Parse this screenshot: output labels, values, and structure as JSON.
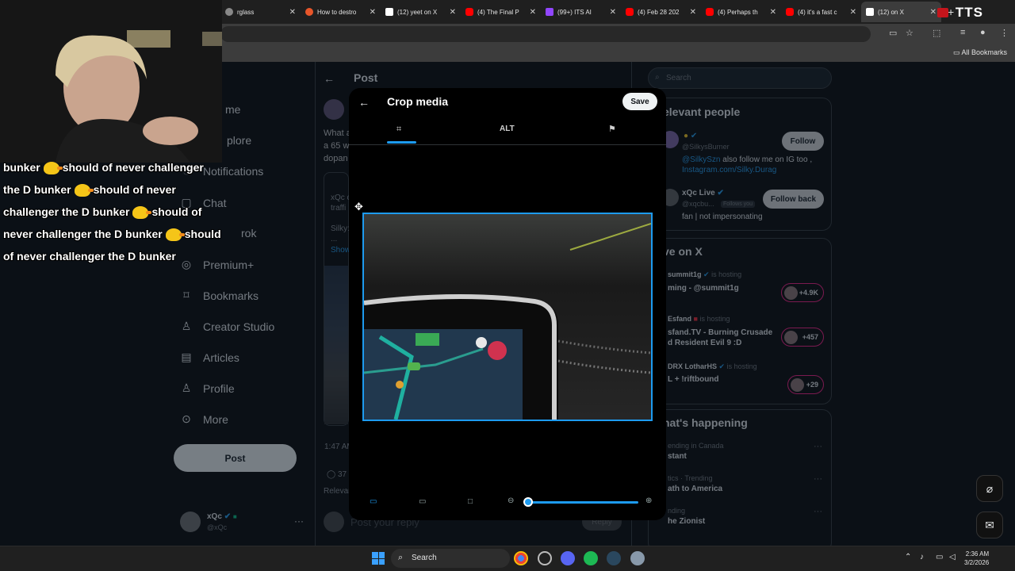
{
  "browser": {
    "tabs": [
      {
        "title": "rglass",
        "color": "#888888"
      },
      {
        "title": "How to destro",
        "color": "#e8562a"
      },
      {
        "title": "(12) yeet on X",
        "color": "#ffffff"
      },
      {
        "title": "(4) The Final P",
        "color": "#ff0000"
      },
      {
        "title": "(99+) ITS AI",
        "color": "#9146ff"
      },
      {
        "title": "(4) Feb 28 202",
        "color": "#ff0000"
      },
      {
        "title": "(4) Perhaps th",
        "color": "#ff0000"
      },
      {
        "title": "(4) it's a fast c",
        "color": "#ff0000"
      },
      {
        "title": "(12) on X",
        "color": "#ffffff"
      }
    ],
    "new_tab": "+",
    "close_glyph": "✕",
    "overlay_brand": "TTS",
    "all_bookmarks": "All Bookmarks"
  },
  "left_nav": {
    "items": [
      {
        "icon": "⌂",
        "label": "Home",
        "visible_label": "me"
      },
      {
        "icon": "⌕",
        "label": "Explore",
        "visible_label": "plore"
      },
      {
        "icon": "🔔",
        "label": "Notifications"
      },
      {
        "icon": "✉",
        "label": "Chat"
      },
      {
        "icon": "Ø",
        "label": "Grok",
        "visible_label": "rok"
      },
      {
        "icon": "✓",
        "label": "Premium+"
      },
      {
        "icon": "🔖",
        "label": "Bookmarks"
      },
      {
        "icon": "⚲",
        "label": "Creator Studio"
      },
      {
        "icon": "▤",
        "label": "Articles"
      },
      {
        "icon": "☺",
        "label": "Profile"
      },
      {
        "icon": "⋯",
        "label": "More"
      }
    ],
    "post_button": "Post",
    "account": {
      "name": "xQc",
      "handle": "@xQc",
      "more": "···"
    }
  },
  "center": {
    "back": "←",
    "title": "Post",
    "bg_text_1": "What a",
    "bg_text_2": "a 65 w",
    "bg_text_3": "dopan",
    "bg_quote_1": "xQc c",
    "bg_quote_2": "traffi",
    "bg_quote_3": "Silky:",
    "bg_quote_4": "...",
    "bg_quote_5": "Show",
    "bg_time": "1:47 AM",
    "bg_count": "37",
    "bg_relevant": "Relevan",
    "reply_placeholder": "Post your reply",
    "reply_button": "Reply"
  },
  "modal": {
    "back": "←",
    "title": "Crop media",
    "save": "Save",
    "tabs": {
      "crop": "⌗",
      "alt": "ALT",
      "flag": "⚑"
    },
    "aspect_icons": [
      "▭",
      "▭",
      "□"
    ],
    "zoom_out": "⊖",
    "zoom_in": "⊕",
    "zoom_level": 0.0
  },
  "right": {
    "search_placeholder": "Search",
    "relevant_title": "Relevant people",
    "relevant_title_visible": "elevant people",
    "people": [
      {
        "handle": "@SilkysBurner",
        "bio_link": "@SilkySzn",
        "bio": " also follow me on IG too ,",
        "bio_link2": "Instagram.com/Silky.Durag",
        "button": "Follow"
      },
      {
        "name": "xQc Live",
        "handle": "@xqcbu...",
        "follows_you": "Follows you",
        "bio": "fan | not impersonating",
        "button": "Follow back"
      }
    ],
    "live_title": "ve on X",
    "live": [
      {
        "host": "summit1g",
        "status": "is hosting",
        "title": "ming - @summit1g",
        "count": "+4.9K"
      },
      {
        "host": "Esfand",
        "status": "is hosting",
        "title_1": "sfand.TV - Burning Crusade",
        "title_2": "d Resident Evil 9 :D",
        "count": "+457"
      },
      {
        "host": "DRX LotharHS",
        "status": "is hosting",
        "title": "L + !riftbound",
        "count": "+29"
      }
    ],
    "happening_title": "hat's happening",
    "trends": [
      {
        "context": "ending in Canada",
        "name": "stant"
      },
      {
        "context": "tics · Trending",
        "name": "ath to America"
      },
      {
        "context": "nding",
        "name": "he Zionist"
      }
    ],
    "more_glyph": "···"
  },
  "chat_overlay": {
    "lines": [
      {
        "pre": "bunker",
        "post": "should of never challenger"
      },
      {
        "pre": "the D bunker",
        "post": "should of never"
      },
      {
        "pre": "challenger the D bunker",
        "post": "should of"
      },
      {
        "pre": "never challenger the D bunker",
        "post": "should"
      },
      {
        "pre": "of never challenger the D bunker",
        "post": ""
      }
    ]
  },
  "taskbar": {
    "search": "Search",
    "time": "2:36 AM",
    "date": "3/2/2026"
  },
  "colors": {
    "accent": "#1d9bf0",
    "bg": "#000000",
    "text": "#e7e9ea",
    "muted": "#71767b",
    "live_pink": "#f91880"
  }
}
